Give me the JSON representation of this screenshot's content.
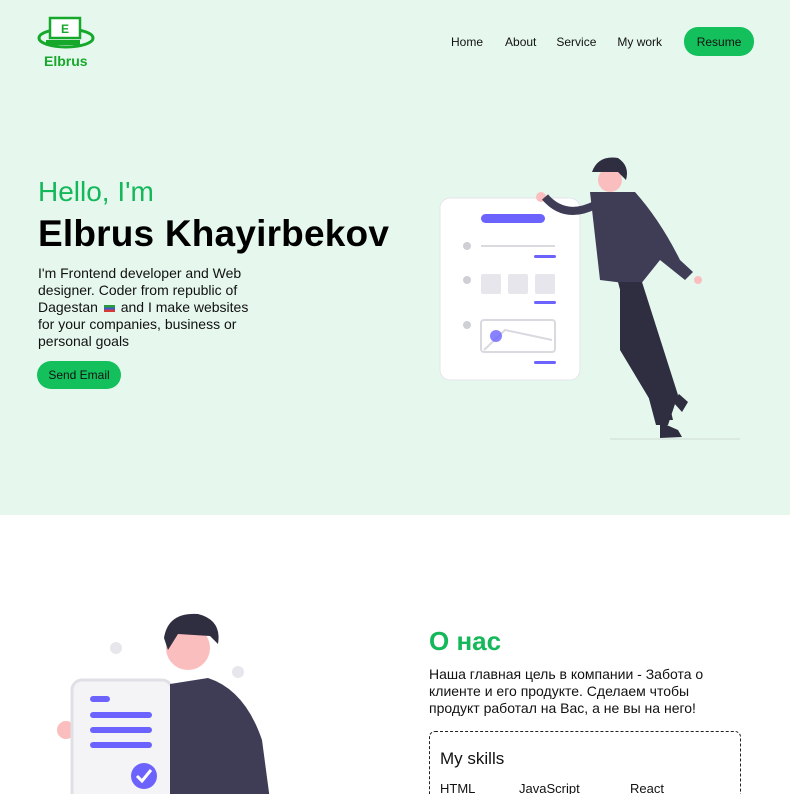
{
  "brand": {
    "name": "Elbrus",
    "logo_letter": "E",
    "color": "#16a82a"
  },
  "nav": {
    "links": [
      "Home",
      "About",
      "Service",
      "My work"
    ],
    "resume_label": "Resume"
  },
  "hero": {
    "greeting": "Hello, I'm",
    "name": "Elbrus Khayirbekov",
    "intro_before_flag": "I'm Frontend developer and Web designer. Coder from republic of Dagestan",
    "intro_after_flag": "and I make websites for your companies, business or personal goals",
    "send_email_label": "Send Email"
  },
  "about": {
    "title": "О нас",
    "text": "Наша главная цель в компании - Забота о клиенте и его продукте. Сделаем чтобы продукт работал на Вас, а не вы на него!",
    "skills_title": "My skills",
    "skills": [
      "HTML",
      "JavaScript",
      "React"
    ]
  },
  "colors": {
    "accent": "#14c05c",
    "hero_bg": "#e6f8ee",
    "illustration_purple": "#6c63ff",
    "illustration_dark": "#3f3d56"
  }
}
